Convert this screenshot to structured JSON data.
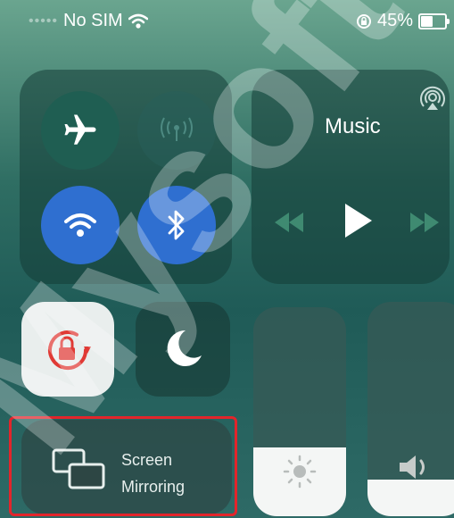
{
  "status_bar": {
    "carrier": "No SIM",
    "battery_percent": "45%",
    "battery_level": 0.45
  },
  "connectivity": {
    "airplane": {
      "icon": "airplane-icon",
      "active": false,
      "color": "#1f5e52"
    },
    "cellular": {
      "icon": "cellular-antenna-icon",
      "active": false
    },
    "wifi": {
      "icon": "wifi-icon",
      "active": true,
      "color": "#2f6fd0"
    },
    "bluetooth": {
      "icon": "bluetooth-icon",
      "active": true,
      "color": "#2f6fd0"
    }
  },
  "music": {
    "title": "Music",
    "airplay_icon": "airplay-icon",
    "controls": [
      "rewind-icon",
      "play-icon",
      "fast-forward-icon"
    ]
  },
  "orientation_lock": {
    "icon": "orientation-lock-icon",
    "active": true,
    "color": "#e03a35"
  },
  "do_not_disturb": {
    "icon": "moon-icon",
    "active": false
  },
  "screen_mirroring": {
    "icon": "screen-mirroring-icon",
    "label_line1": "Screen",
    "label_line2": "Mirroring"
  },
  "brightness": {
    "icon": "sun-icon",
    "level": 0.33
  },
  "volume": {
    "icon": "speaker-icon",
    "level": 0.17
  },
  "watermark": "Mysoft"
}
